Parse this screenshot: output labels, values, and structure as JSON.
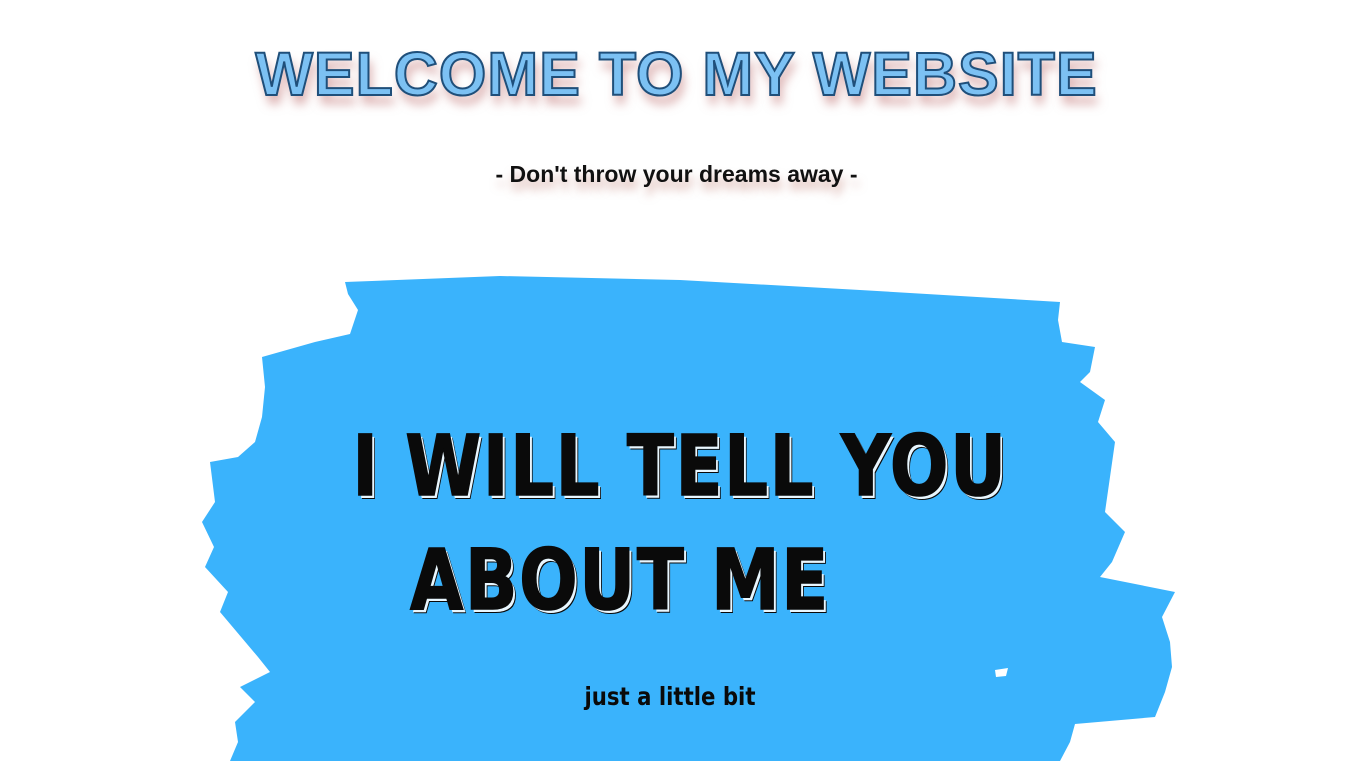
{
  "header": {
    "title": "WELCOME TO MY WEBSITE",
    "tagline": "- Don't throw your dreams away -"
  },
  "hero": {
    "heading_line_1": "I WILL TELL YOU",
    "heading_line_2": "ABOUT ME",
    "subtext": "just a little bit",
    "brush_color": "#3ab3fc",
    "text_color": "#0a0a0a"
  }
}
